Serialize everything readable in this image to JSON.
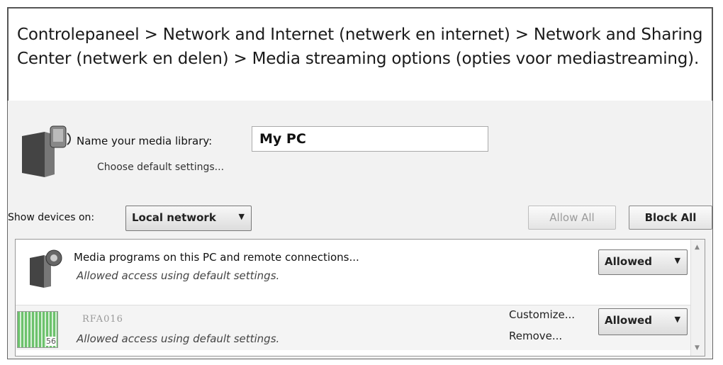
{
  "caption": {
    "text": "Controlepaneel > Network and Internet (netwerk en internet) > Network and Sharing Center (netwerk en delen) > Media streaming options (opties voor mediastreaming)."
  },
  "library": {
    "name_label": "Name your media library:",
    "name_value": "My PC",
    "default_link": "Choose default settings..."
  },
  "devices": {
    "show_label": "Show devices on:",
    "show_value": "Local network",
    "allow_all_label": "Allow All",
    "block_all_label": "Block All"
  },
  "list": {
    "rows": [
      {
        "title": "Media programs on this PC and remote connections...",
        "subtitle": "Allowed access using default settings.",
        "status": "Allowed"
      },
      {
        "title": "RFA016",
        "thumb_number": "56",
        "subtitle": "Allowed access using default settings.",
        "customize_label": "Customize...",
        "remove_label": "Remove...",
        "status": "Allowed"
      }
    ]
  },
  "icons": {
    "library": "media-library-icon",
    "media_program": "media-program-icon",
    "device": "device-thumbnail-icon",
    "dropdown": "chevron-down-icon",
    "scroll_up": "scroll-up-icon",
    "scroll_down": "scroll-down-icon"
  }
}
